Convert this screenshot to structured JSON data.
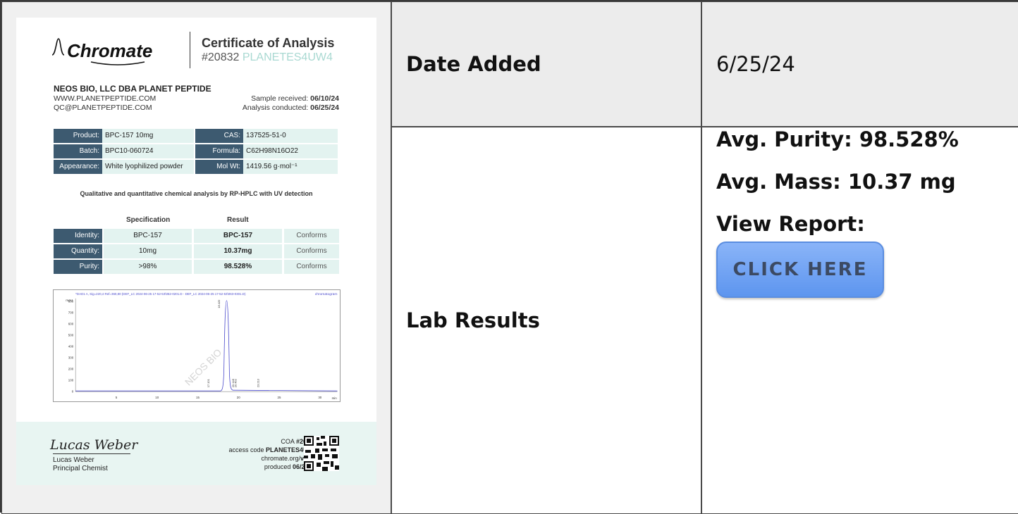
{
  "rows": {
    "date_label": "Date Added",
    "date_value": "6/25/24",
    "lab_label": "Lab Results"
  },
  "lab": {
    "purity_label": "Avg. Purity:",
    "purity_value": "98.528%",
    "mass_label": "Avg. Mass:",
    "mass_value": "10.37 mg",
    "report_label": "View Report:",
    "button_label": "CLICK HERE"
  },
  "coa": {
    "logo": "Chromate",
    "title": "Certificate of Analysis",
    "number": "#20832",
    "code": "PLANETES4UW4",
    "company": "NEOS BIO, LLC DBA PLANET PEPTIDE",
    "website": "WWW.PLANETPEPTIDE.COM",
    "email": "QC@PLANETPEPTIDE.COM",
    "received_label": "Sample received:",
    "received_value": "06/10/24",
    "conducted_label": "Analysis conducted:",
    "conducted_value": "06/25/24",
    "info": [
      {
        "k1": "Product:",
        "v1": "BPC-157 10mg",
        "k2": "CAS:",
        "v2": "137525-51-0"
      },
      {
        "k1": "Batch:",
        "v1": "BPC10-060724",
        "k2": "Formula:",
        "v2": "C62H98N16O22"
      },
      {
        "k1": "Appearance:",
        "v1": "White lyophilized powder",
        "k2": "Mol Wt:",
        "v2": "1419.56 g·mol⁻¹"
      }
    ],
    "method": "Qualitative and quantitative chemical analysis by RP-HPLC with UV detection",
    "spec_header": "Specification",
    "result_header": "Result",
    "results": [
      {
        "name": "Identity:",
        "spec": "BPC-157",
        "result": "BPC-157",
        "status": "Conforms"
      },
      {
        "name": "Quantity:",
        "spec": "10mg",
        "result": "10.37mg",
        "status": "Conforms"
      },
      {
        "name": "Purity:",
        "spec": ">98%",
        "result": "98.528%",
        "status": "Conforms"
      }
    ],
    "chrom_header": "*DAD1 A, Sig=220,4 Ref=360,80 (DEF_LC 2024-06-25 17-52-53\\062-0201.D - DEF_LC 2024-06-25 17-52-53\\063-0301.D)",
    "chrom_tag": "chromatogram",
    "chrom_unit": "mAU",
    "chrom_xunit": "min",
    "watermark": "NEOS BIO",
    "chrom_y_ticks": [
      "800",
      "700",
      "600",
      "500",
      "400",
      "300",
      "200",
      "100",
      "0"
    ],
    "chrom_x_ticks": [
      "5",
      "10",
      "15",
      "20",
      "25",
      "30"
    ],
    "peaks": [
      "17.101",
      "18.420",
      "20.148",
      "20.452",
      "23.213"
    ],
    "signature": "Lucas Weber",
    "chemist_name": "Lucas Weber",
    "chemist_role": "Principal Chemist",
    "foot_coa_label": "COA",
    "foot_coa_value": "#20832",
    "foot_access_label": "access code",
    "foot_access_value": "PLANETES4UW4",
    "foot_site_a": "chromate.org/",
    "foot_site_b": "verify",
    "foot_produced_label": "produced",
    "foot_produced_value": "06/25/24"
  },
  "colors": {
    "button": "#6fa3f3",
    "header_cell": "#3d5a70",
    "value_cell": "#e3f3f0",
    "accent": "#a9d9d2"
  }
}
